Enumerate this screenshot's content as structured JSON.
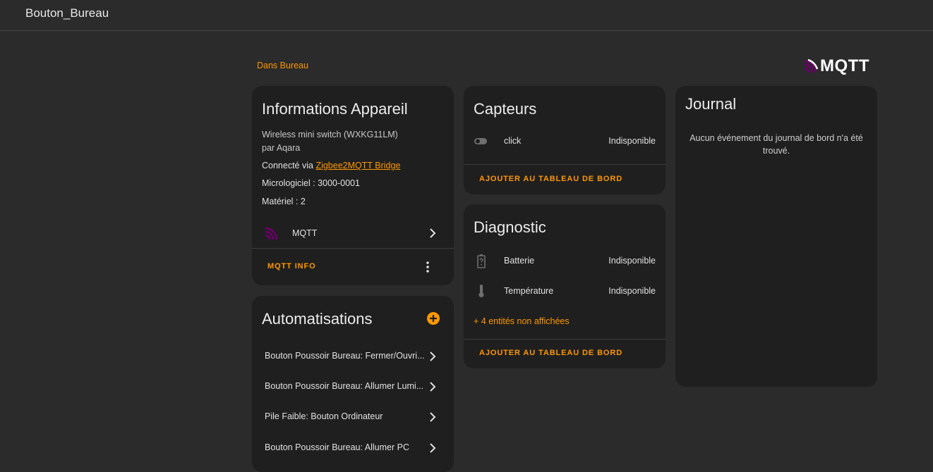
{
  "header": {
    "title": "Bouton_Bureau"
  },
  "area": {
    "label": "Dans Bureau"
  },
  "logo": {
    "text": "MQTT",
    "color": "#660066"
  },
  "device_info": {
    "title": "Informations Appareil",
    "model": "Wireless mini switch (WXKG11LM)",
    "manufacturer": "par Aqara",
    "connected_prefix": "Connecté via ",
    "connected_link": "Zigbee2MQTT Bridge",
    "firmware": "Micrologiciel : 3000-0001",
    "hardware": "Matériel : 2",
    "integration": {
      "label": "MQTT",
      "icon": "mqtt-icon"
    },
    "action_label": "MQTT INFO"
  },
  "automations": {
    "title": "Automatisations",
    "items": [
      {
        "label": "Bouton Poussoir Bureau: Fermer/Ouvri..."
      },
      {
        "label": "Bouton Poussoir Bureau: Allumer Lumi..."
      },
      {
        "label": "Pile Faible: Bouton Ordinateur"
      },
      {
        "label": "Bouton Poussoir Bureau: Allumer PC"
      }
    ]
  },
  "sensors": {
    "title": "Capteurs",
    "items": [
      {
        "name": "click",
        "state": "Indisponible",
        "icon": "toggle-switch-icon"
      }
    ],
    "action_label": "AJOUTER AU TABLEAU DE BORD"
  },
  "diagnostic": {
    "title": "Diagnostic",
    "items": [
      {
        "name": "Batterie",
        "state": "Indisponible",
        "icon": "battery-unknown-icon"
      },
      {
        "name": "Température",
        "state": "Indisponible",
        "icon": "thermometer-icon"
      }
    ],
    "hidden_entities": "+ 4 entités non affichées",
    "action_label": "AJOUTER AU TABLEAU DE BORD"
  },
  "logbook": {
    "title": "Journal",
    "empty_message": "Aucun événement du journal de bord n'a été trouvé."
  },
  "colors": {
    "accent": "#ff9800",
    "card": "#1f1f1f",
    "background": "#2b2b2b"
  }
}
